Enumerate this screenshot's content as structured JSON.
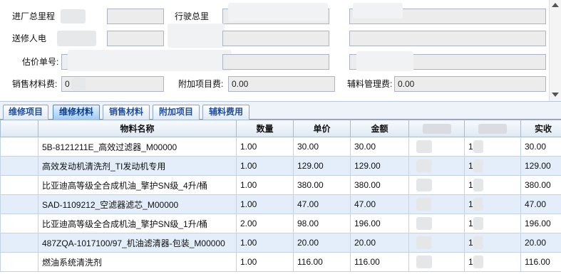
{
  "form": {
    "entry_mileage_label": "进厂总里程",
    "travel_total_label": "行驶总里",
    "sender_label": "送修人电",
    "estimate_no_label": "估价单号:",
    "sales_material_fee_label": "销售材料费:",
    "sales_material_fee_value": "0",
    "extra_item_fee_label": "附加项目费:",
    "extra_item_fee_value": "0.00",
    "aux_material_mgmt_fee_label": "辅料管理费:",
    "aux_material_mgmt_fee_value": "0.00"
  },
  "tabs": [
    {
      "label": "维修项目",
      "active": false
    },
    {
      "label": "维修材料",
      "active": true
    },
    {
      "label": "销售材料",
      "active": false
    },
    {
      "label": "附加项目",
      "active": false
    },
    {
      "label": "辅料费用",
      "active": false
    }
  ],
  "grid": {
    "columns": [
      "",
      "物料名称",
      "数量",
      "单价",
      "金额",
      "",
      "",
      "实收"
    ],
    "rows": [
      {
        "name": "5B-8121211E_高效过滤器_M00000",
        "qty": "1.00",
        "price": "30.00",
        "amount": "30.00",
        "col6": "1",
        "received": "30.00"
      },
      {
        "name": "高效发动机清洗剂_TI发动机专用",
        "qty": "1.00",
        "price": "129.00",
        "amount": "129.00",
        "col6": "1",
        "received": "129.00"
      },
      {
        "name": "比亚迪高等级全合成机油_擎护SN级_4升/桶",
        "qty": "1.00",
        "price": "380.00",
        "amount": "380.00",
        "col6": "1",
        "received": "380.00"
      },
      {
        "name": "SAD-1109212_空滤器滤芯_M00000",
        "qty": "1.00",
        "price": "47.00",
        "amount": "47.00",
        "col6": "1",
        "received": "47.00"
      },
      {
        "name": "比亚迪高等级全合成机油_擎护SN级_1升/桶",
        "qty": "2.00",
        "price": "98.00",
        "amount": "196.00",
        "col6": "1",
        "received": "196.00"
      },
      {
        "name": "487ZQA-1017100/97_机油滤清器-包装_M00000",
        "qty": "1.00",
        "price": "20.00",
        "amount": "20.00",
        "col6": "1",
        "received": "20.00"
      },
      {
        "name": "燃油系统清洗剂",
        "qty": "1.00",
        "price": "116.00",
        "amount": "116.00",
        "col6": "1",
        "received": "116.00"
      }
    ]
  }
}
